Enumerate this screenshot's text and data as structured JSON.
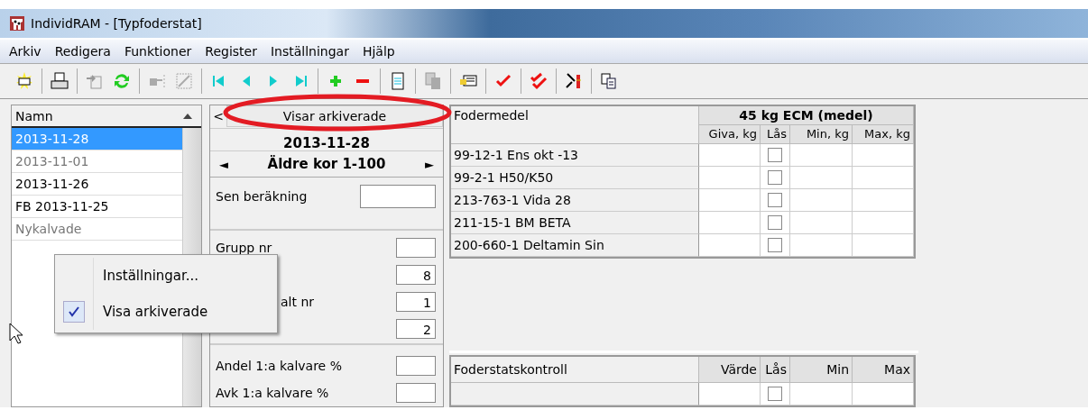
{
  "window": {
    "title": "IndividRAM - [Typfoderstat]"
  },
  "menu": [
    "Arkiv",
    "Redigera",
    "Funktioner",
    "Register",
    "Inställningar",
    "Hjälp"
  ],
  "list": {
    "header": "Namn",
    "items": [
      {
        "label": "2013-11-28",
        "selected": true,
        "archived": false
      },
      {
        "label": "2013-11-01",
        "selected": false,
        "archived": true
      },
      {
        "label": "2013-11-26",
        "selected": false,
        "archived": false
      },
      {
        "label": "FB 2013-11-25",
        "selected": false,
        "archived": false
      },
      {
        "label": "Nykalvade",
        "selected": false,
        "archived": true
      }
    ]
  },
  "context_menu": [
    {
      "label": "Inställningar...",
      "checked": false
    },
    {
      "label": "Visa arkiverade",
      "checked": true
    }
  ],
  "middle": {
    "back": "<",
    "archive_button": "Visar arkiverade",
    "date": "2013-11-28",
    "group_prev": "◄",
    "group_name": "Äldre kor 1-100",
    "group_next": "►",
    "calc_label": "Sen beräkning",
    "fields": [
      {
        "label": "Grupp nr"
      },
      {
        "value": "8"
      },
      {
        "label": "alt nr",
        "value": "1"
      },
      {
        "value": "2"
      }
    ],
    "ratios": [
      {
        "label": "Andel 1:a kalvare %"
      },
      {
        "label": "Avk 1:a kalvare %"
      }
    ]
  },
  "feed_table": {
    "name_header": "Fodermedel",
    "group_header": "45 kg ECM (medel)",
    "columns": [
      "Giva, kg",
      "Lås",
      "Min, kg",
      "Max, kg"
    ],
    "rows": [
      {
        "name": "99-12-1 Ens okt -13",
        "locked": false
      },
      {
        "name": "99-2-1 H50/K50",
        "locked": false
      },
      {
        "name": "213-763-1 Vida 28",
        "locked": false
      },
      {
        "name": "211-15-1 BM BETA",
        "locked": false
      },
      {
        "name": "200-660-1 Deltamin Sin",
        "locked": false
      }
    ]
  },
  "control_table": {
    "name_header": "Foderstatskontroll",
    "columns": [
      "Värde",
      "Lås",
      "Min",
      "Max"
    ],
    "rows": [
      {
        "locked": false
      }
    ]
  }
}
